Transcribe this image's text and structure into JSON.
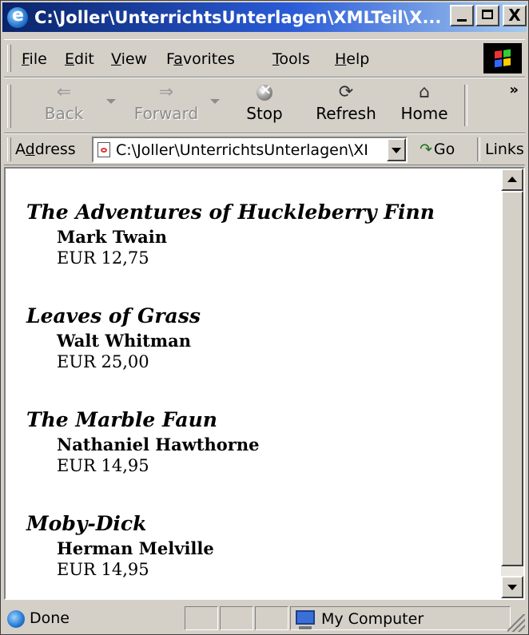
{
  "window": {
    "title": "C:\\Joller\\UnterrichtsUnterlagen\\XMLTeil\\X...",
    "minimize_label": "_",
    "close_label": "X"
  },
  "menu": {
    "items": [
      {
        "underline": "F",
        "rest": "ile"
      },
      {
        "underline": "E",
        "rest": "dit"
      },
      {
        "underline": "V",
        "rest": "iew"
      },
      {
        "pre": "F",
        "underline": "a",
        "rest": "vorites"
      },
      {
        "underline": "T",
        "rest": "ools"
      },
      {
        "underline": "H",
        "rest": "elp"
      }
    ]
  },
  "toolbar": {
    "back_label": "Back",
    "back_glyph": "⇐",
    "forward_label": "Forward",
    "forward_glyph": "⇒",
    "stop_label": "Stop",
    "refresh_label": "Refresh",
    "refresh_glyph": "⟳",
    "home_label": "Home",
    "home_glyph": "⌂",
    "more_glyph": "»"
  },
  "address": {
    "label_pre": "A",
    "label_underline": "d",
    "label_rest": "dress",
    "value": "C:\\Joller\\UnterrichtsUnterlagen\\XI",
    "go_glyph": "↷",
    "go_label": "Go",
    "links_label": "Links"
  },
  "books": [
    {
      "title": "The Adventures of Huckleberry Finn",
      "author": "Mark Twain",
      "price": "EUR 12,75"
    },
    {
      "title": "Leaves of Grass",
      "author": "Walt Whitman",
      "price": "EUR 25,00"
    },
    {
      "title": "The Marble Faun",
      "author": "Nathaniel Hawthorne",
      "price": "EUR 14,95"
    },
    {
      "title": "Moby-Dick",
      "author": "Herman Melville",
      "price": "EUR 14,95"
    }
  ],
  "status": {
    "text": "Done",
    "zone": "My Computer"
  }
}
